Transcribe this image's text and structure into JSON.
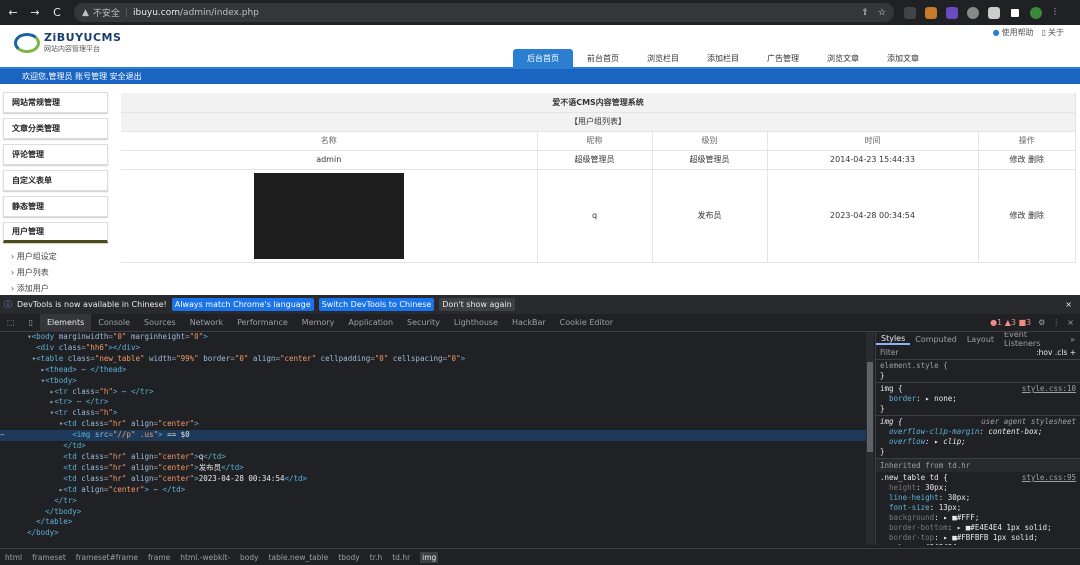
{
  "browser": {
    "back": "←",
    "forward": "→",
    "reload": "C",
    "security": "不安全",
    "url_host": "ibuyu.com",
    "url_path": "/admin/index.php"
  },
  "site": {
    "logo_name": "ZiBUYUCMS",
    "logo_sub": "网站内容管理平台",
    "help": "使用帮助",
    "about": "关于"
  },
  "tabs": [
    "后台首页",
    "前台首页",
    "浏览栏目",
    "添加栏目",
    "广告管理",
    "浏览文章",
    "添加文章"
  ],
  "welcome": "欢迎您,管理员 账号管理 安全退出",
  "sidebar": {
    "items": [
      "网站常规管理",
      "文章分类管理",
      "评论管理",
      "自定义表单",
      "静态管理",
      "用户管理"
    ],
    "subs": [
      "› 用户组设定",
      "› 用户列表",
      "› 添加用户"
    ]
  },
  "table": {
    "title": "爱不语CMS内容管理系统",
    "subtitle": "【用户组列表】",
    "headers": [
      "名称",
      "昵称",
      "级别",
      "时间",
      "操作"
    ],
    "rows": [
      {
        "name": "admin",
        "nick": "超级管理员",
        "level": "超级管理员",
        "time": "2014-04-23 15:44:33",
        "op": "修改 删除"
      },
      {
        "name": "",
        "nick": "q",
        "level": "发布员",
        "time": "2023-04-28 00:34:54",
        "op": "修改 删除"
      }
    ]
  },
  "devtools": {
    "info": "DevTools is now available in Chinese!",
    "btn1": "Always match Chrome's language",
    "btn2": "Switch DevTools to Chinese",
    "btn3": "Don't show again",
    "tabs": [
      "Elements",
      "Console",
      "Sources",
      "Network",
      "Performance",
      "Memory",
      "Application",
      "Security",
      "Lighthouse",
      "HackBar",
      "Cookie Editor"
    ],
    "badges": "●1 ▲3 ■3",
    "styles_tabs": [
      "Styles",
      "Computed",
      "Layout",
      "Event Listeners"
    ],
    "filter": "Filter",
    "filter_right": ":hov .cls +",
    "inherited": "Inherited from td.hr",
    "breadcrumb": [
      "html",
      "frameset",
      "frameset#frame",
      "frame",
      "html.-webkit-",
      "body",
      "table.new_table",
      "tbody",
      "tr.h",
      "td.hr",
      "img"
    ]
  },
  "colors": {
    "accent": "#2c7fd0",
    "bar": "#1b65c2",
    "dt_bg": "#202124"
  }
}
